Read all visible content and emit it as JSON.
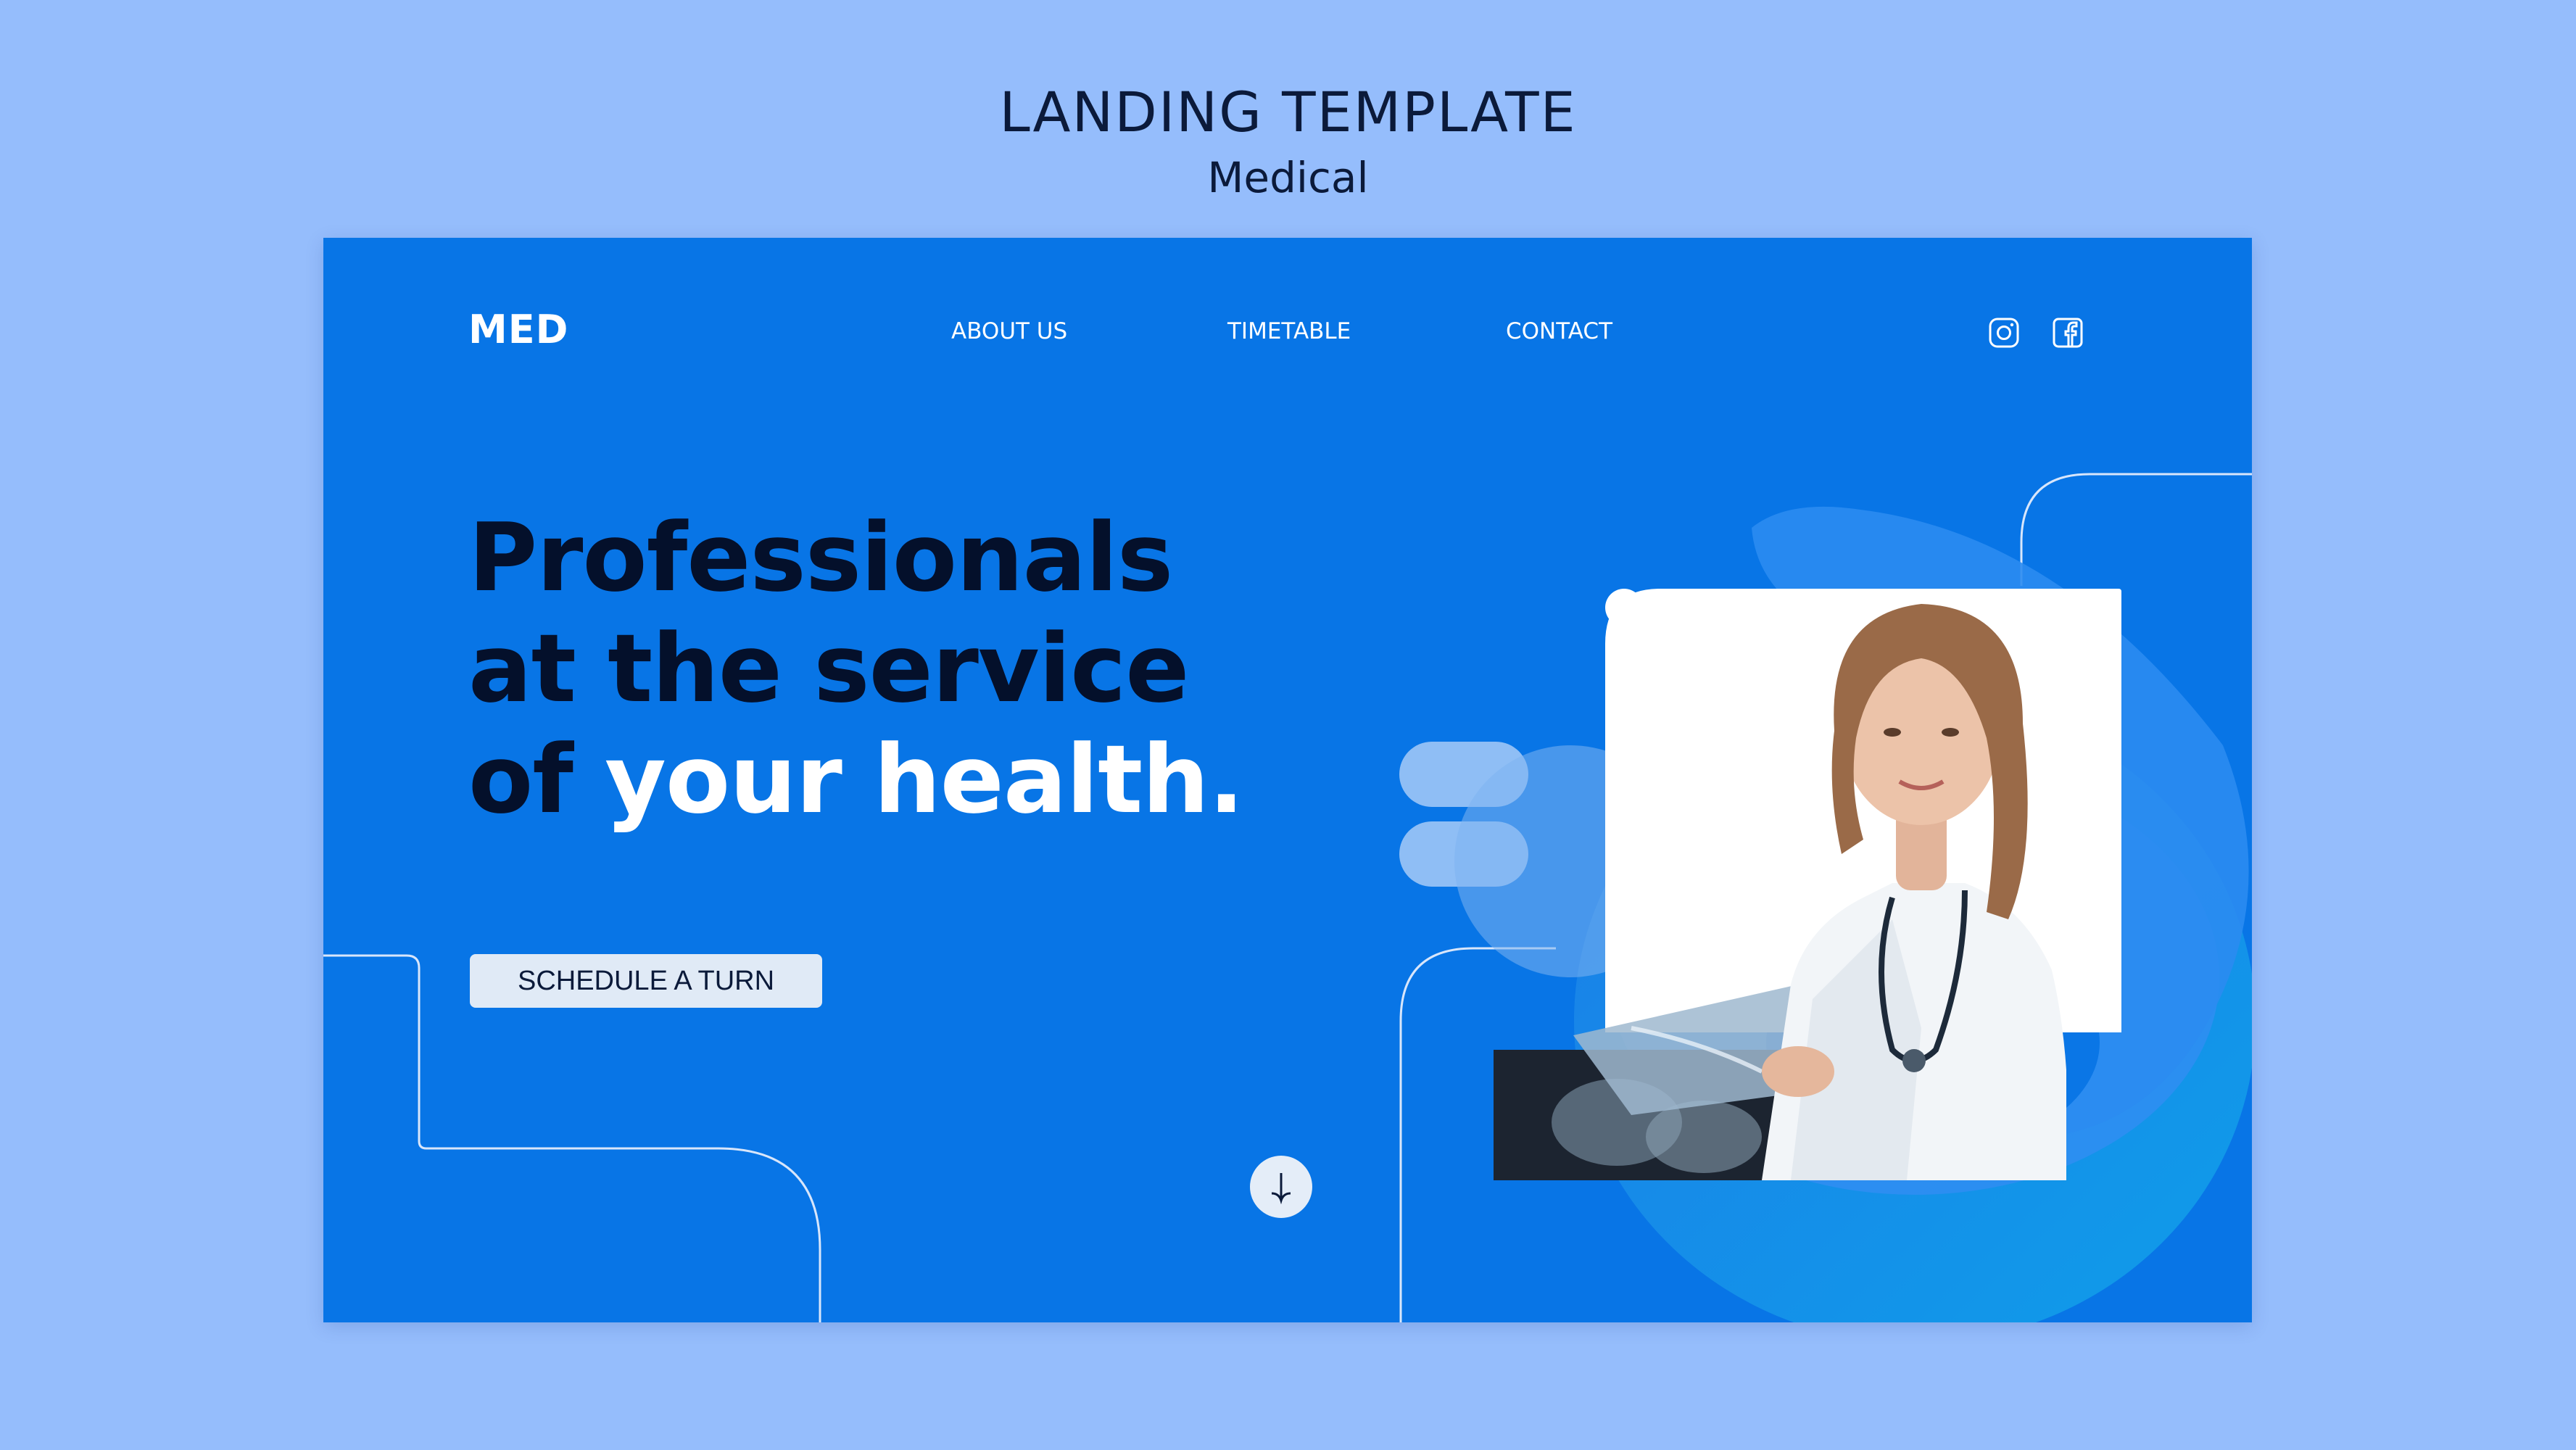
{
  "page_heading": {
    "title": "LANDING TEMPLATE",
    "subtitle": "Medical"
  },
  "landing": {
    "brand": "MED",
    "nav": {
      "items": [
        {
          "label": "ABOUT US"
        },
        {
          "label": "TIMETABLE"
        },
        {
          "label": "CONTACT"
        }
      ]
    },
    "social": [
      {
        "icon": "instagram-icon"
      },
      {
        "icon": "facebook-icon"
      }
    ],
    "headline": {
      "line1": "Professionals",
      "line2": "at the service",
      "line3_dark": "of",
      "line3_light": "your health."
    },
    "cta_label": "SCHEDULE A TURN",
    "scroll_icon": "arrow-down-icon",
    "hero_image": "doctor-with-xray-photo"
  },
  "colors": {
    "page_background": "#95bdfc",
    "panel_background": "#0875e6",
    "headline_dark": "#04102b",
    "headline_light": "#ffffff",
    "button_background": "#e0eaf6"
  }
}
